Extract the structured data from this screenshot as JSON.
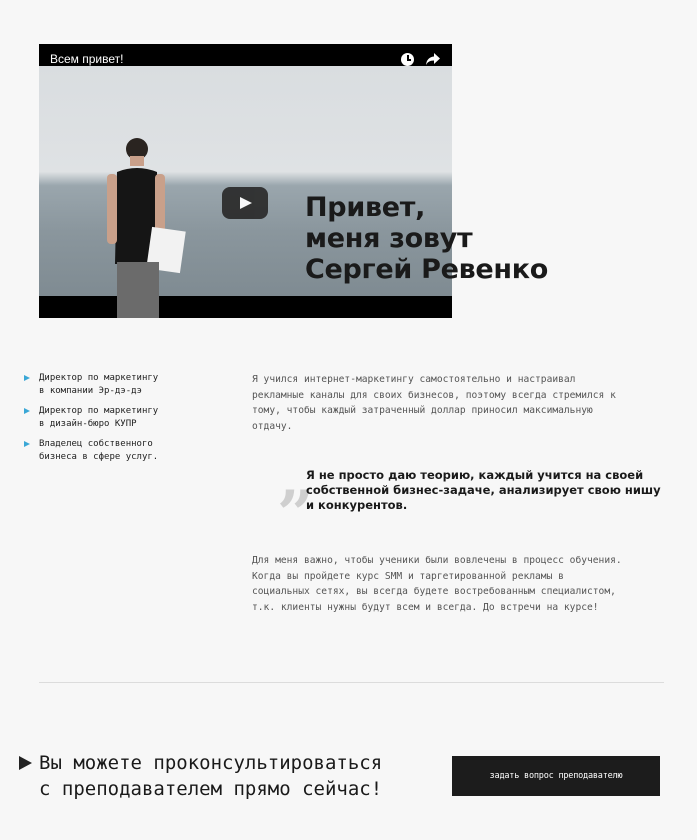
{
  "video": {
    "title": "Всем привет!",
    "icons": [
      "clock-icon",
      "share-icon",
      "play-icon"
    ]
  },
  "hero": {
    "title_lines": [
      "Привет,",
      "меня зовут",
      "Сергей Ревенко"
    ]
  },
  "positions": [
    {
      "lines": [
        "Директор по маркетингу",
        "в компании Эр-дэ-дэ"
      ]
    },
    {
      "lines": [
        "Директор по маркетингу",
        "в дизайн-бюро КУПР"
      ]
    },
    {
      "lines": [
        "Владелец собственного",
        "бизнеса в сфере услуг."
      ]
    }
  ],
  "paragraph1": [
    "Я учился интернет-маркетингу самостоятельно и настраивал",
    "рекламные каналы для своих бизнесов, поэтому всегда стремился к",
    "тому, чтобы каждый затраченный доллар приносил максимальную",
    "отдачу."
  ],
  "quote": {
    "mark": "”",
    "lines": [
      "Я не просто даю теорию, каждый учится на своей",
      "собственной бизнес-задаче, анализирует свою нишу",
      "и конкурентов."
    ]
  },
  "paragraph2": [
    "Для меня важно, чтобы ученики были вовлечены в процесс обучения.",
    "Когда вы пройдете курс SMM и таргетированной рекламы в",
    "социальных сетях, вы всегда будете востребованным специалистом,",
    "т.к. клиенты нужны будут всем и всегда. До встречи на курсе!"
  ],
  "cta": {
    "lines": [
      "Вы можете проконсультироваться",
      "с преподавателем прямо сейчас!"
    ],
    "button_label": "задать вопрос преподавателю"
  },
  "colors": {
    "background": "#f7f7f7",
    "accent_bullet": "#3aa7d6",
    "button": "#1c1c1c"
  }
}
